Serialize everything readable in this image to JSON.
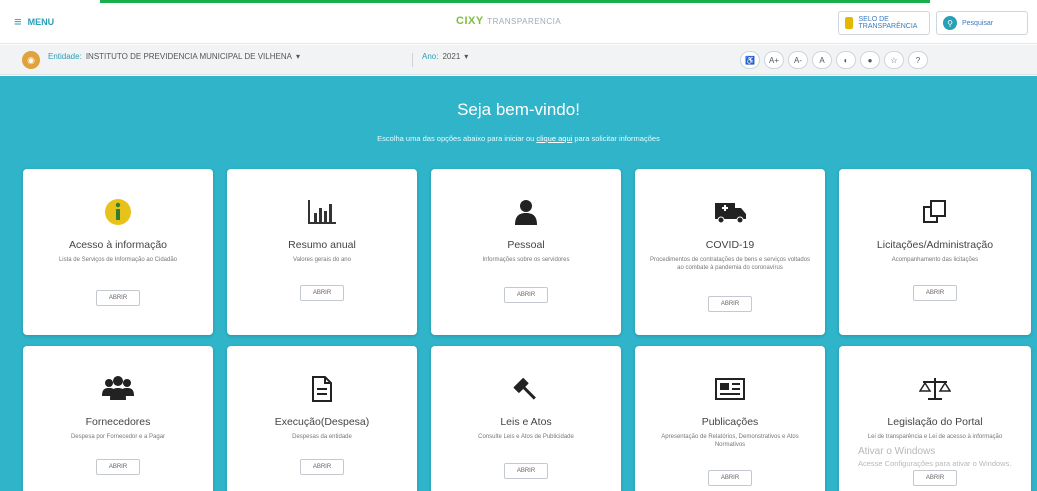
{
  "header": {
    "menu_label": "MENU",
    "logo_brand": "CIXY",
    "logo_rest": "TRANSPARENCIA",
    "seal_label": "SELO DE TRANSPARÊNCIA",
    "user_label": "Pesquisar"
  },
  "entity_bar": {
    "entity_key": "Entidade:",
    "entity_value": "INSTITUTO DE PREVIDENCIA MUNICIPAL DE VILHENA",
    "year_key": "Ano:",
    "year_value": "2021",
    "tools": [
      "♿",
      "A+",
      "A-",
      "A",
      "◐",
      "●",
      "☆",
      "?"
    ]
  },
  "hero": {
    "welcome": "Seja bem-vindo!",
    "subtitle_pre": "Escolha uma das opções abaixo para iniciar ou ",
    "subtitle_link": "clique aqui",
    "subtitle_post": " para solicitar informações"
  },
  "cards": [
    {
      "title": "Acesso à informação",
      "desc": "Lista de Serviços de Informação ao Cidadão",
      "button": "ABRIR",
      "icon": "info-icon"
    },
    {
      "title": "Resumo anual",
      "desc": "Valores gerais do ano",
      "button": "ABRIR",
      "icon": "bar-chart-icon"
    },
    {
      "title": "Pessoal",
      "desc": "Informações sobre os servidores",
      "button": "ABRIR",
      "icon": "person-icon"
    },
    {
      "title": "COVID-19",
      "desc": "Procedimentos de contratações de bens e serviços voltados ao combate à pandemia do coronavírus",
      "button": "ABRIR",
      "icon": "ambulance-icon"
    },
    {
      "title": "Licitações/Administração",
      "desc": "Acompanhamento das licitações",
      "button": "ABRIR",
      "icon": "copy-icon"
    },
    {
      "title": "Fornecedores",
      "desc": "Despesa por Fornecedor e a Pagar",
      "button": "ABRIR",
      "icon": "group-icon"
    },
    {
      "title": "Execução(Despesa)",
      "desc": "Despesas da entidade",
      "button": "ABRIR",
      "icon": "document-icon"
    },
    {
      "title": "Leis e Atos",
      "desc": "Consulte Leis e Atos de Publicidade",
      "button": "ABRIR",
      "icon": "gavel-icon"
    },
    {
      "title": "Publicações",
      "desc": "Apresentação de Relatórios, Demonstrativos e Atos Normativos",
      "button": "ABRIR",
      "icon": "newspaper-icon"
    },
    {
      "title": "Legislação do Portal",
      "desc": "Lei de transparência e Lei de acesso à informação",
      "button": "ABRIR",
      "icon": "scales-icon"
    }
  ],
  "watermark": {
    "line1": "Ativar o Windows",
    "line2": "Acesse Configurações para ativar o Windows."
  }
}
